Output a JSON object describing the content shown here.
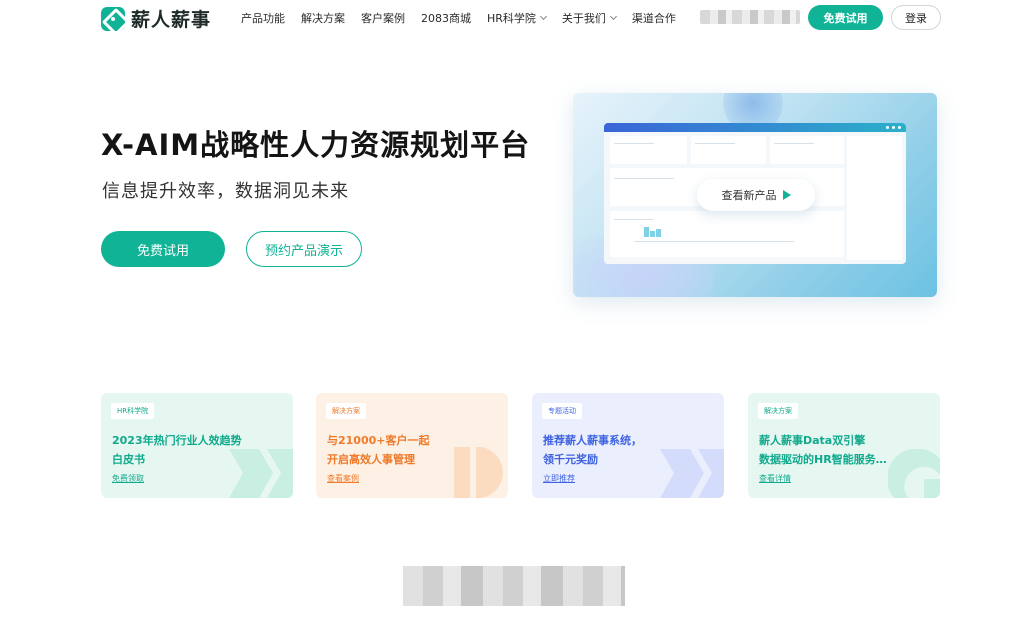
{
  "brand": {
    "name": "薪人薪事",
    "color": "#10b396"
  },
  "nav": [
    {
      "label": "产品功能",
      "has_dropdown": false
    },
    {
      "label": "解决方案",
      "has_dropdown": false
    },
    {
      "label": "客户案例",
      "has_dropdown": false
    },
    {
      "label": "2083商城",
      "has_dropdown": false
    },
    {
      "label": "HR科学院",
      "has_dropdown": true
    },
    {
      "label": "关于我们",
      "has_dropdown": true
    },
    {
      "label": "渠道合作",
      "has_dropdown": false
    }
  ],
  "header": {
    "trial_label": "免费试用",
    "login_label": "登录"
  },
  "hero": {
    "title": "X-AIM战略性人力资源规划平台",
    "subtitle": "信息提升效率，数据洞见未来",
    "trial_label": "免费试用",
    "demo_label": "预约产品演示"
  },
  "preview": {
    "cta_label": "查看新产品"
  },
  "cards": [
    {
      "tag": "HR科学院",
      "title_line1": "2023年热门行业人效趋势",
      "title_line2": "白皮书",
      "link": "免费领取",
      "accent": "#10a98c"
    },
    {
      "tag": "解决方案",
      "title_line1": "与21000+客户一起",
      "title_line2": "开启高效人事管理",
      "link": "查看案例",
      "accent": "#ef7a2a"
    },
    {
      "tag": "专题活动",
      "title_line1": "推荐薪人薪事系统，",
      "title_line2": "领千元奖励",
      "link": "立即推荐",
      "accent": "#3f63e0"
    },
    {
      "tag": "解决方案",
      "title_line1": "薪人薪事Data双引擎",
      "title_line2": "数据驱动的HR智能服务…",
      "link": "查看详情",
      "accent": "#10a98c"
    }
  ]
}
